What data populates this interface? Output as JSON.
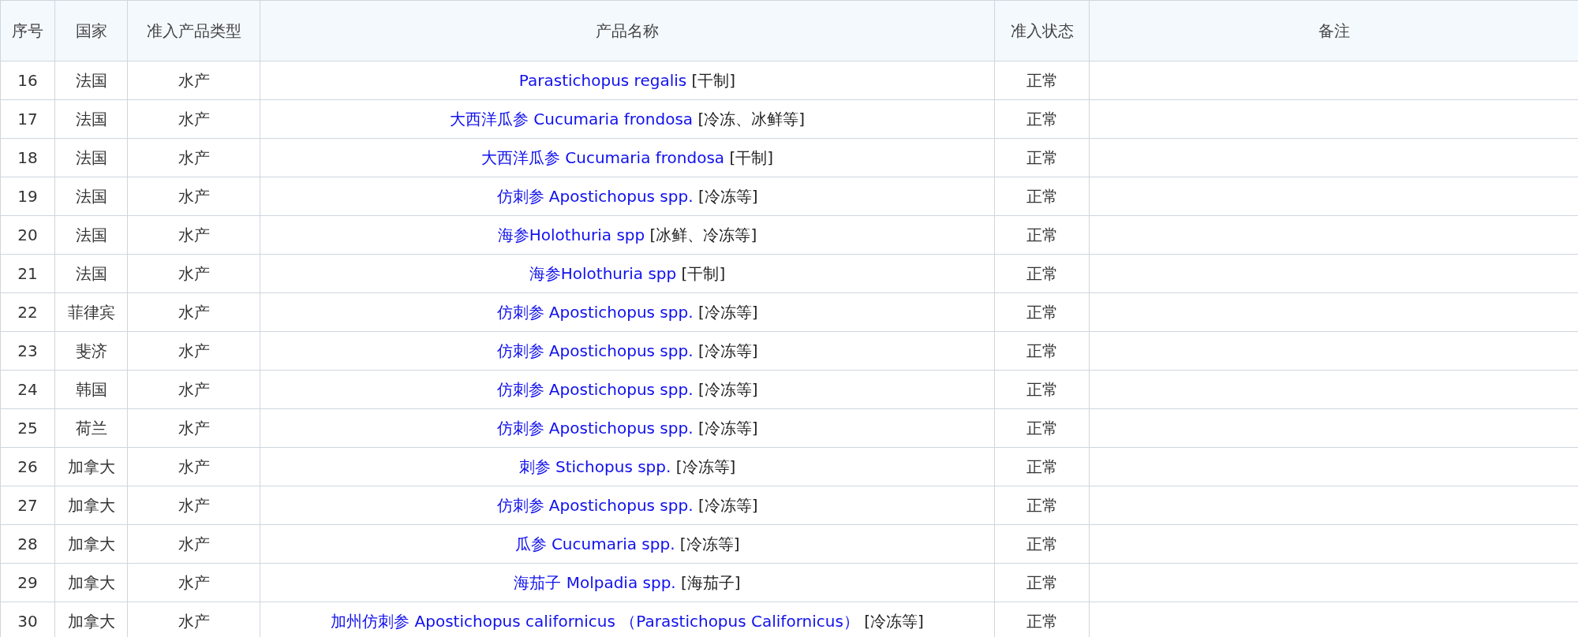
{
  "table": {
    "columns": [
      "序号",
      "国家",
      "准入产品类型",
      "产品名称",
      "准入状态",
      "备注"
    ],
    "rows": [
      {
        "no": "16",
        "country": "法国",
        "type": "水产",
        "product_link": "Parastichopus regalis",
        "product_form": "[干制]",
        "status": "正常"
      },
      {
        "no": "17",
        "country": "法国",
        "type": "水产",
        "product_link": "大西洋瓜参 Cucumaria frondosa",
        "product_form": "[冷冻、冰鲜等]",
        "status": "正常"
      },
      {
        "no": "18",
        "country": "法国",
        "type": "水产",
        "product_link": "大西洋瓜参 Cucumaria frondosa",
        "product_form": "[干制]",
        "status": "正常"
      },
      {
        "no": "19",
        "country": "法国",
        "type": "水产",
        "product_link": "仿刺参 Apostichopus spp.",
        "product_form": "[冷冻等]",
        "status": "正常"
      },
      {
        "no": "20",
        "country": "法国",
        "type": "水产",
        "product_link": "海参Holothuria spp",
        "product_form": "[冰鲜、冷冻等]",
        "status": "正常"
      },
      {
        "no": "21",
        "country": "法国",
        "type": "水产",
        "product_link": "海参Holothuria spp",
        "product_form": "[干制]",
        "status": "正常"
      },
      {
        "no": "22",
        "country": "菲律宾",
        "type": "水产",
        "product_link": "仿刺参 Apostichopus spp.",
        "product_form": "[冷冻等]",
        "status": "正常"
      },
      {
        "no": "23",
        "country": "斐济",
        "type": "水产",
        "product_link": "仿刺参 Apostichopus spp.",
        "product_form": "[冷冻等]",
        "status": "正常"
      },
      {
        "no": "24",
        "country": "韩国",
        "type": "水产",
        "product_link": "仿刺参 Apostichopus spp.",
        "product_form": "[冷冻等]",
        "status": "正常"
      },
      {
        "no": "25",
        "country": "荷兰",
        "type": "水产",
        "product_link": "仿刺参 Apostichopus spp.",
        "product_form": "[冷冻等]",
        "status": "正常"
      },
      {
        "no": "26",
        "country": "加拿大",
        "type": "水产",
        "product_link": "刺参 Stichopus spp.",
        "product_form": "[冷冻等]",
        "status": "正常"
      },
      {
        "no": "27",
        "country": "加拿大",
        "type": "水产",
        "product_link": "仿刺参 Apostichopus spp.",
        "product_form": "[冷冻等]",
        "status": "正常"
      },
      {
        "no": "28",
        "country": "加拿大",
        "type": "水产",
        "product_link": "瓜参 Cucumaria spp.",
        "product_form": "[冷冻等]",
        "status": "正常"
      },
      {
        "no": "29",
        "country": "加拿大",
        "type": "水产",
        "product_link": "海茄子 Molpadia spp.",
        "product_form": "[海茄子]",
        "status": "正常"
      },
      {
        "no": "30",
        "country": "加拿大",
        "type": "水产",
        "product_link": "加州仿刺参 Apostichopus californicus （Parastichopus Californicus）",
        "product_form": "[冷冻等]",
        "status": "正常"
      }
    ]
  }
}
